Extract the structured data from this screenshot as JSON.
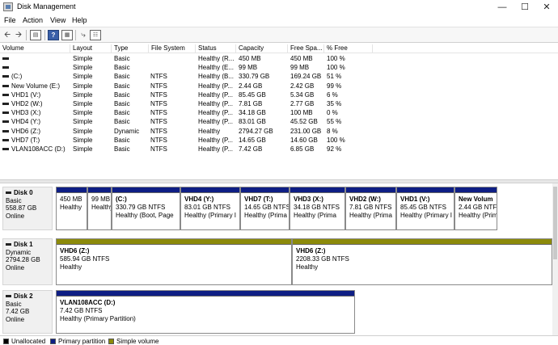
{
  "window": {
    "title": "Disk Management"
  },
  "menu": [
    "File",
    "Action",
    "View",
    "Help"
  ],
  "toolbar_icons": [
    "back-arrow-icon",
    "forward-arrow-icon",
    "console-tree-icon",
    "help-icon",
    "properties-icon",
    "connect-icon",
    "settings-icon"
  ],
  "volume_columns": [
    "Volume",
    "Layout",
    "Type",
    "File System",
    "Status",
    "Capacity",
    "Free Spa...",
    "% Free"
  ],
  "volumes": [
    [
      "",
      "Simple",
      "Basic",
      "",
      "Healthy (R...",
      "450 MB",
      "450 MB",
      "100 %"
    ],
    [
      "",
      "Simple",
      "Basic",
      "",
      "Healthy (E...",
      "99 MB",
      "99 MB",
      "100 %"
    ],
    [
      "(C:)",
      "Simple",
      "Basic",
      "NTFS",
      "Healthy (B...",
      "330.79 GB",
      "169.24 GB",
      "51 %"
    ],
    [
      "New Volume (E:)",
      "Simple",
      "Basic",
      "NTFS",
      "Healthy (P...",
      "2.44 GB",
      "2.42 GB",
      "99 %"
    ],
    [
      "VHD1 (V:)",
      "Simple",
      "Basic",
      "NTFS",
      "Healthy (P...",
      "85.45 GB",
      "5.34 GB",
      "6 %"
    ],
    [
      "VHD2 (W:)",
      "Simple",
      "Basic",
      "NTFS",
      "Healthy (P...",
      "7.81 GB",
      "2.77 GB",
      "35 %"
    ],
    [
      "VHD3 (X:)",
      "Simple",
      "Basic",
      "NTFS",
      "Healthy (P...",
      "34.18 GB",
      "100 MB",
      "0 %"
    ],
    [
      "VHD4 (Y:)",
      "Simple",
      "Basic",
      "NTFS",
      "Healthy (P...",
      "83.01 GB",
      "45.52 GB",
      "55 %"
    ],
    [
      "VHD6 (Z:)",
      "Simple",
      "Dynamic",
      "NTFS",
      "Healthy",
      "2794.27 GB",
      "231.00 GB",
      "8 %"
    ],
    [
      "VHD7 (T:)",
      "Simple",
      "Basic",
      "NTFS",
      "Healthy (P...",
      "14.65 GB",
      "14.60 GB",
      "100 %"
    ],
    [
      "VLAN108ACC (D:)",
      "Simple",
      "Basic",
      "NTFS",
      "Healthy (P...",
      "7.42 GB",
      "6.85 GB",
      "92 %"
    ]
  ],
  "disks": [
    {
      "name": "Disk 0",
      "type": "Basic",
      "size": "558.87 GB",
      "state": "Online",
      "partitions": [
        {
          "bar": "primary",
          "name": "",
          "size": "450 MB",
          "status": "Healthy"
        },
        {
          "bar": "primary",
          "name": "",
          "size": "99 MB",
          "status": "Healthy"
        },
        {
          "bar": "primary",
          "name": "(C:)",
          "size": "330.79 GB NTFS",
          "status": "Healthy (Boot, Page"
        },
        {
          "bar": "primary",
          "name": "VHD4 (Y:)",
          "size": "83.01 GB NTFS",
          "status": "Healthy (Primary I"
        },
        {
          "bar": "primary",
          "name": "VHD7 (T:)",
          "size": "14.65 GB NTFS",
          "status": "Healthy (Prima"
        },
        {
          "bar": "primary",
          "name": "VHD3 (X:)",
          "size": "34.18 GB NTFS",
          "status": "Healthy (Prima"
        },
        {
          "bar": "primary",
          "name": "VHD2 (W:)",
          "size": "7.81 GB NTFS",
          "status": "Healthy (Prima"
        },
        {
          "bar": "primary",
          "name": "VHD1 (V:)",
          "size": "85.45 GB NTFS",
          "status": "Healthy (Primary I"
        },
        {
          "bar": "primary",
          "name": "New Volum",
          "size": "2.44 GB NTFS",
          "status": "Healthy (Prim"
        }
      ]
    },
    {
      "name": "Disk 1",
      "type": "Dynamic",
      "size": "2794.28 GB",
      "state": "Online",
      "partitions": [
        {
          "bar": "simple",
          "name": "VHD6 (Z:)",
          "size": "585.94 GB NTFS",
          "status": "Healthy"
        },
        {
          "bar": "simple",
          "name": "VHD6 (Z:)",
          "size": "2208.33 GB NTFS",
          "status": "Healthy"
        }
      ]
    },
    {
      "name": "Disk 2",
      "type": "Basic",
      "size": "7.42 GB",
      "state": "Online",
      "partitions": [
        {
          "bar": "primary",
          "name": "VLAN108ACC (D:)",
          "size": "7.42 GB NTFS",
          "status": "Healthy (Primary Partition)"
        }
      ]
    }
  ],
  "legend": [
    {
      "label": "Unallocated",
      "color": "#000000"
    },
    {
      "label": "Primary partition",
      "color": "#0e1e84"
    },
    {
      "label": "Simple volume",
      "color": "#8c8a0a"
    }
  ],
  "colors": {
    "primary": "#0e1e84",
    "simple": "#8c8a0a",
    "unallocated": "#000000"
  }
}
